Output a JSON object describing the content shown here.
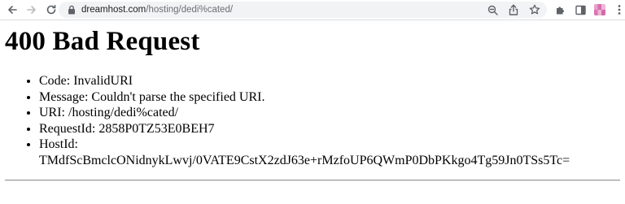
{
  "browser": {
    "url_host": "dreamhost.com",
    "url_path": "/hosting/dedi%cated/",
    "icons": {
      "back": "arrow-left-icon",
      "forward": "arrow-right-icon",
      "reload": "reload-icon",
      "lock": "lock-icon",
      "zoom": "zoom-icon",
      "share": "share-icon",
      "bookmark": "star-icon",
      "extensions": "puzzle-icon",
      "sidepanel": "sidepanel-icon",
      "menu": "kebab-menu-icon"
    }
  },
  "page": {
    "title": "400 Bad Request",
    "items": [
      "Code: InvalidURI",
      "Message: Couldn't parse the specified URI.",
      "URI: /hosting/dedi%cated/",
      "RequestId: 2858P0TZ53E0BEH7"
    ],
    "hostid_label": "HostId:",
    "hostid_value": "TMdfScBmclcONidnykLwvj/0VATE9CstX2zdJ63e+rMzfoUP6QWmP0DbPKkgo4Tg59Jn0TSs5Tc="
  }
}
